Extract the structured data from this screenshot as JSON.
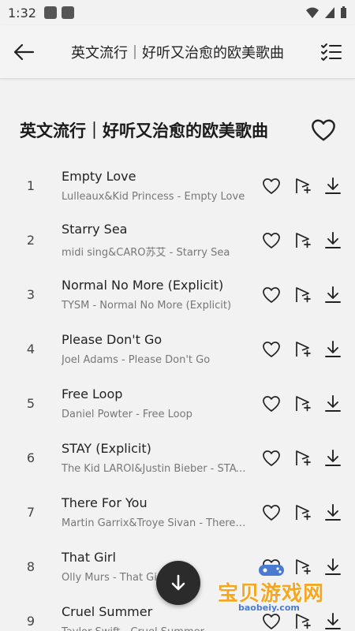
{
  "status_bar": {
    "time": "1:32"
  },
  "app_bar": {
    "title": "英文流行｜好听又治愈的欧美歌曲"
  },
  "playlist": {
    "title": "英文流行｜好听又治愈的欧美歌曲"
  },
  "songs": [
    {
      "index": "1",
      "title": "Empty Love",
      "subtitle": "Lulleaux&Kid Princess - Empty Love"
    },
    {
      "index": "2",
      "title": "Starry Sea",
      "subtitle": "midi sing&CARO苏艾 - Starry Sea"
    },
    {
      "index": "3",
      "title": "Normal No More (Explicit)",
      "subtitle": "TYSM - Normal No More (Explicit)"
    },
    {
      "index": "4",
      "title": "Please Don't Go",
      "subtitle": "Joel Adams - Please Don't Go"
    },
    {
      "index": "5",
      "title": "Free Loop",
      "subtitle": "Daniel Powter - Free Loop"
    },
    {
      "index": "6",
      "title": "STAY (Explicit)",
      "subtitle": "The Kid LAROI&Justin Bieber - STAY (Explicit)"
    },
    {
      "index": "7",
      "title": "There For You",
      "subtitle": "Martin Garrix&Troye Sivan - There For You"
    },
    {
      "index": "8",
      "title": "That Girl",
      "subtitle": "Olly Murs - That Girl"
    },
    {
      "index": "9",
      "title": "Cruel Summer",
      "subtitle": "Taylor Swift - Cruel Summer"
    }
  ],
  "watermark": {
    "text": "宝贝游戏网",
    "url": "baobeiy.com"
  },
  "colors": {
    "background": "#f2f2f2",
    "fab": "#2b2b2b",
    "watermark_orange": "#f5a623",
    "watermark_blue": "#4a7bd0"
  }
}
